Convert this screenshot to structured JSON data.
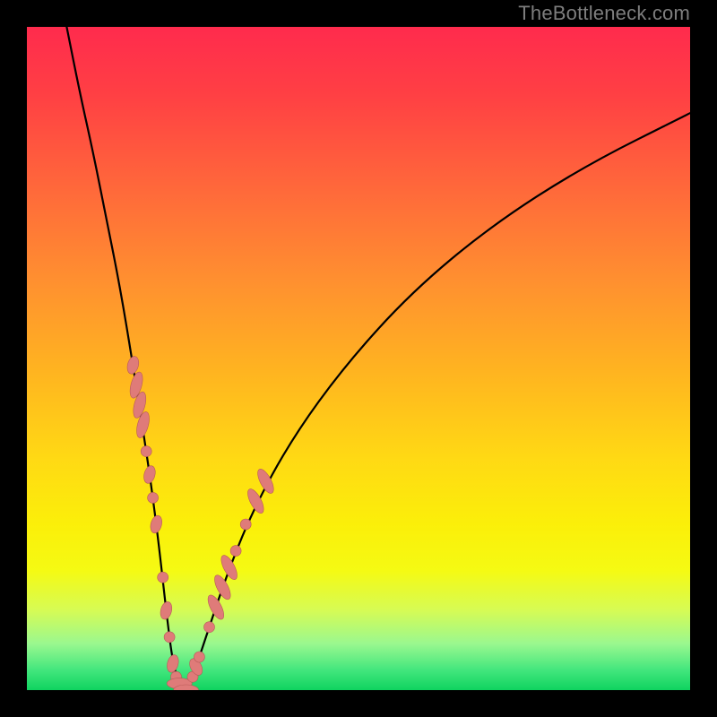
{
  "watermark": "TheBottleneck.com",
  "colors": {
    "curve_stroke": "#000000",
    "marker_fill": "#df7b79",
    "marker_stroke": "#b85a57",
    "frame_bg": "#000000"
  },
  "chart_data": {
    "type": "line",
    "title": "",
    "xlabel": "",
    "ylabel": "",
    "xlim": [
      0,
      100
    ],
    "ylim": [
      0,
      100
    ],
    "grid": false,
    "series": [
      {
        "name": "bottleneck_curve",
        "x": [
          6,
          8,
          10,
          12,
          14,
          16,
          18,
          19,
          20,
          21,
          22,
          23,
          24,
          25,
          27,
          30,
          34,
          40,
          48,
          58,
          70,
          84,
          100
        ],
        "y": [
          100,
          90,
          81,
          71,
          61,
          49,
          36,
          29,
          21,
          12,
          4,
          1,
          0,
          2,
          8,
          17,
          27,
          38,
          49,
          60,
          70,
          79,
          87
        ]
      }
    ],
    "markers": [
      {
        "x": 16.0,
        "y": 49.0,
        "shape": "oval_short_diag_nw"
      },
      {
        "x": 16.5,
        "y": 46.0,
        "shape": "oval_long_diag_nw"
      },
      {
        "x": 17.0,
        "y": 43.0,
        "shape": "oval_long_diag_nw"
      },
      {
        "x": 17.5,
        "y": 40.0,
        "shape": "oval_long_diag_nw"
      },
      {
        "x": 18.0,
        "y": 36.0,
        "shape": "circle_small"
      },
      {
        "x": 18.5,
        "y": 32.5,
        "shape": "oval_short_diag_nw"
      },
      {
        "x": 19.0,
        "y": 29.0,
        "shape": "circle_small"
      },
      {
        "x": 19.5,
        "y": 25.0,
        "shape": "oval_short_diag_nw"
      },
      {
        "x": 20.5,
        "y": 17.0,
        "shape": "circle_small"
      },
      {
        "x": 21.0,
        "y": 12.0,
        "shape": "oval_short_diag_nw"
      },
      {
        "x": 21.5,
        "y": 8.0,
        "shape": "circle_small"
      },
      {
        "x": 22.0,
        "y": 4.0,
        "shape": "oval_short_diag_nw"
      },
      {
        "x": 22.5,
        "y": 2.0,
        "shape": "circle_small"
      },
      {
        "x": 23.0,
        "y": 1.0,
        "shape": "oval_long_flat"
      },
      {
        "x": 24.0,
        "y": 0.0,
        "shape": "oval_long_flat"
      },
      {
        "x": 25.0,
        "y": 2.0,
        "shape": "circle_small"
      },
      {
        "x": 25.5,
        "y": 3.5,
        "shape": "oval_short_diag_ne"
      },
      {
        "x": 26.0,
        "y": 5.0,
        "shape": "circle_small"
      },
      {
        "x": 27.5,
        "y": 9.5,
        "shape": "circle_small"
      },
      {
        "x": 28.5,
        "y": 12.5,
        "shape": "oval_long_diag_ne"
      },
      {
        "x": 29.5,
        "y": 15.5,
        "shape": "oval_long_diag_ne"
      },
      {
        "x": 30.5,
        "y": 18.5,
        "shape": "oval_long_diag_ne"
      },
      {
        "x": 31.5,
        "y": 21.0,
        "shape": "circle_small"
      },
      {
        "x": 33.0,
        "y": 25.0,
        "shape": "circle_small"
      },
      {
        "x": 34.5,
        "y": 28.5,
        "shape": "oval_long_diag_ne"
      },
      {
        "x": 36.0,
        "y": 31.5,
        "shape": "oval_long_diag_ne"
      }
    ]
  }
}
